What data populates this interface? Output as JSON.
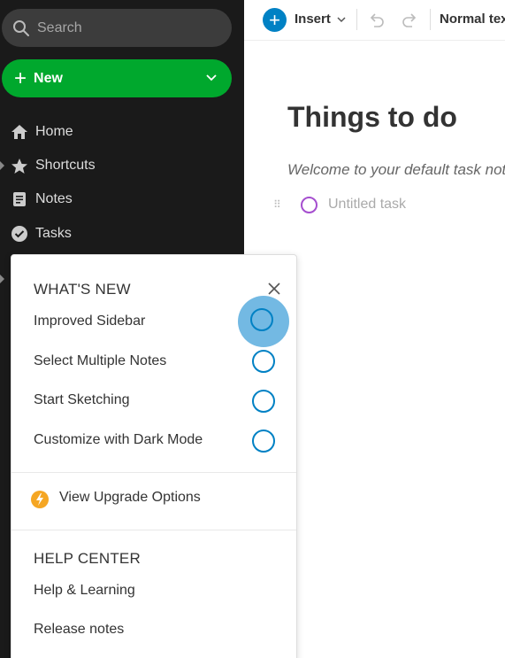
{
  "sidebar": {
    "search_placeholder": "Search",
    "new_label": "New",
    "nav": [
      {
        "label": "Home",
        "icon": "home-icon"
      },
      {
        "label": "Shortcuts",
        "icon": "star-icon"
      },
      {
        "label": "Notes",
        "icon": "notes-icon"
      },
      {
        "label": "Tasks",
        "icon": "tasks-icon"
      }
    ]
  },
  "toolbar": {
    "insert_label": "Insert",
    "format_label": "Normal text"
  },
  "note": {
    "title": "Things to do",
    "subtitle": "Welcome to your default task note",
    "task_placeholder": "Untitled task"
  },
  "whats_new": {
    "heading": "WHAT'S NEW",
    "features": [
      {
        "label": "Improved Sidebar"
      },
      {
        "label": "Select Multiple Notes"
      },
      {
        "label": "Start Sketching"
      },
      {
        "label": "Customize with Dark Mode"
      }
    ],
    "upgrade_label": "View Upgrade Options",
    "help_heading": "HELP CENTER",
    "help_links": [
      {
        "label": "Help & Learning"
      },
      {
        "label": "Release notes"
      }
    ]
  },
  "colors": {
    "sidebar_bg": "#1a1a1a",
    "new_button": "#00a82d",
    "accent_blue": "#0081c4",
    "task_purple": "#a54ecf",
    "upgrade_orange": "#f5a623"
  }
}
